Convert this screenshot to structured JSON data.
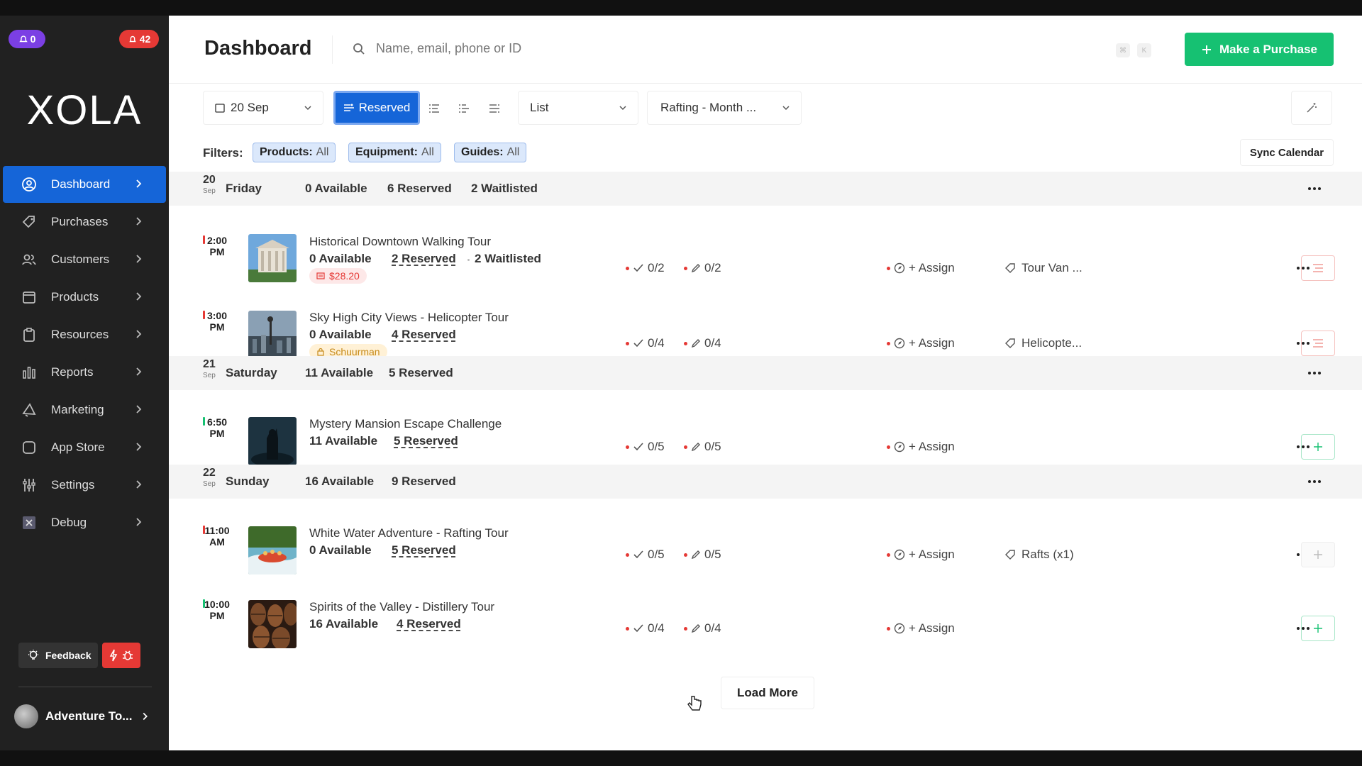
{
  "sidebar": {
    "badge_left": "0",
    "badge_right": "42",
    "logo": "XOLA",
    "items": [
      {
        "label": "Dashboard",
        "icon": "dashboard-icon",
        "active": true
      },
      {
        "label": "Purchases",
        "icon": "tag-icon"
      },
      {
        "label": "Customers",
        "icon": "users-icon"
      },
      {
        "label": "Products",
        "icon": "box-icon"
      },
      {
        "label": "Resources",
        "icon": "clipboard-icon"
      },
      {
        "label": "Reports",
        "icon": "bar-chart-icon"
      },
      {
        "label": "Marketing",
        "icon": "megaphone-icon"
      },
      {
        "label": "App Store",
        "icon": "square-icon"
      },
      {
        "label": "Settings",
        "icon": "sliders-icon"
      },
      {
        "label": "Debug",
        "icon": "x-box-icon"
      }
    ],
    "feedback_label": "Feedback",
    "account_name": "Adventure To..."
  },
  "header": {
    "title": "Dashboard",
    "search_placeholder": "Name, email, phone or ID",
    "kbd_1": "⌘",
    "kbd_2": "K",
    "purchase_label": "Make a Purchase"
  },
  "toolbar": {
    "date": "20 Sep",
    "reserved": "Reserved",
    "view": "List",
    "calendar": "Rafting - Month ..."
  },
  "filters": {
    "label": "Filters:",
    "chips": [
      {
        "name": "Products:",
        "value": "All"
      },
      {
        "name": "Equipment:",
        "value": "All"
      },
      {
        "name": "Guides:",
        "value": "All"
      }
    ],
    "sync": "Sync Calendar"
  },
  "days": [
    {
      "num": "20",
      "month": "Sep",
      "name": "Friday",
      "stats": [
        "0 Available",
        "6 Reserved",
        "2 Waitlisted"
      ]
    },
    {
      "num": "21",
      "month": "Sep",
      "name": "Saturday",
      "stats": [
        "11 Available",
        "5 Reserved"
      ]
    },
    {
      "num": "22",
      "month": "Sep",
      "name": "Sunday",
      "stats": [
        "16 Available",
        "9 Reserved"
      ]
    }
  ],
  "events": [
    {
      "time1": "2:00",
      "time2": "PM",
      "name": "Historical Downtown Walking Tour",
      "avail": "0 Available",
      "reserved": "2 Reserved",
      "waitlisted": "2 Waitlisted",
      "pill": "$28.20",
      "check": "0/2",
      "edit": "0/2",
      "assign": "+ Assign",
      "tag": "Tour Van ..."
    },
    {
      "time1": "3:00",
      "time2": "PM",
      "name": "Sky High City Views - Helicopter Tour",
      "avail": "0 Available",
      "reserved": "4 Reserved",
      "pill": "Schuurman",
      "check": "0/4",
      "edit": "0/4",
      "assign": "+ Assign",
      "tag": "Helicopte..."
    },
    {
      "time1": "6:50",
      "time2": "PM",
      "name": "Mystery Mansion Escape Challenge",
      "avail": "11 Available",
      "reserved": "5 Reserved",
      "check": "0/5",
      "edit": "0/5",
      "assign": "+ Assign"
    },
    {
      "time1": "11:00",
      "time2": "AM",
      "name": "White Water Adventure - Rafting Tour",
      "avail": "0 Available",
      "reserved": "5 Reserved",
      "check": "0/5",
      "edit": "0/5",
      "assign": "+ Assign",
      "tag": "Rafts (x1)"
    },
    {
      "time1": "10:00",
      "time2": "PM",
      "name": "Spirits of the Valley - Distillery Tour",
      "avail": "16 Available",
      "reserved": "4 Reserved",
      "check": "0/4",
      "edit": "0/4",
      "assign": "+ Assign"
    }
  ],
  "load_more": "Load More",
  "colors": {
    "accent": "#1565d8",
    "green": "#16c172",
    "red": "#e53935",
    "sidebar": "#212121"
  }
}
